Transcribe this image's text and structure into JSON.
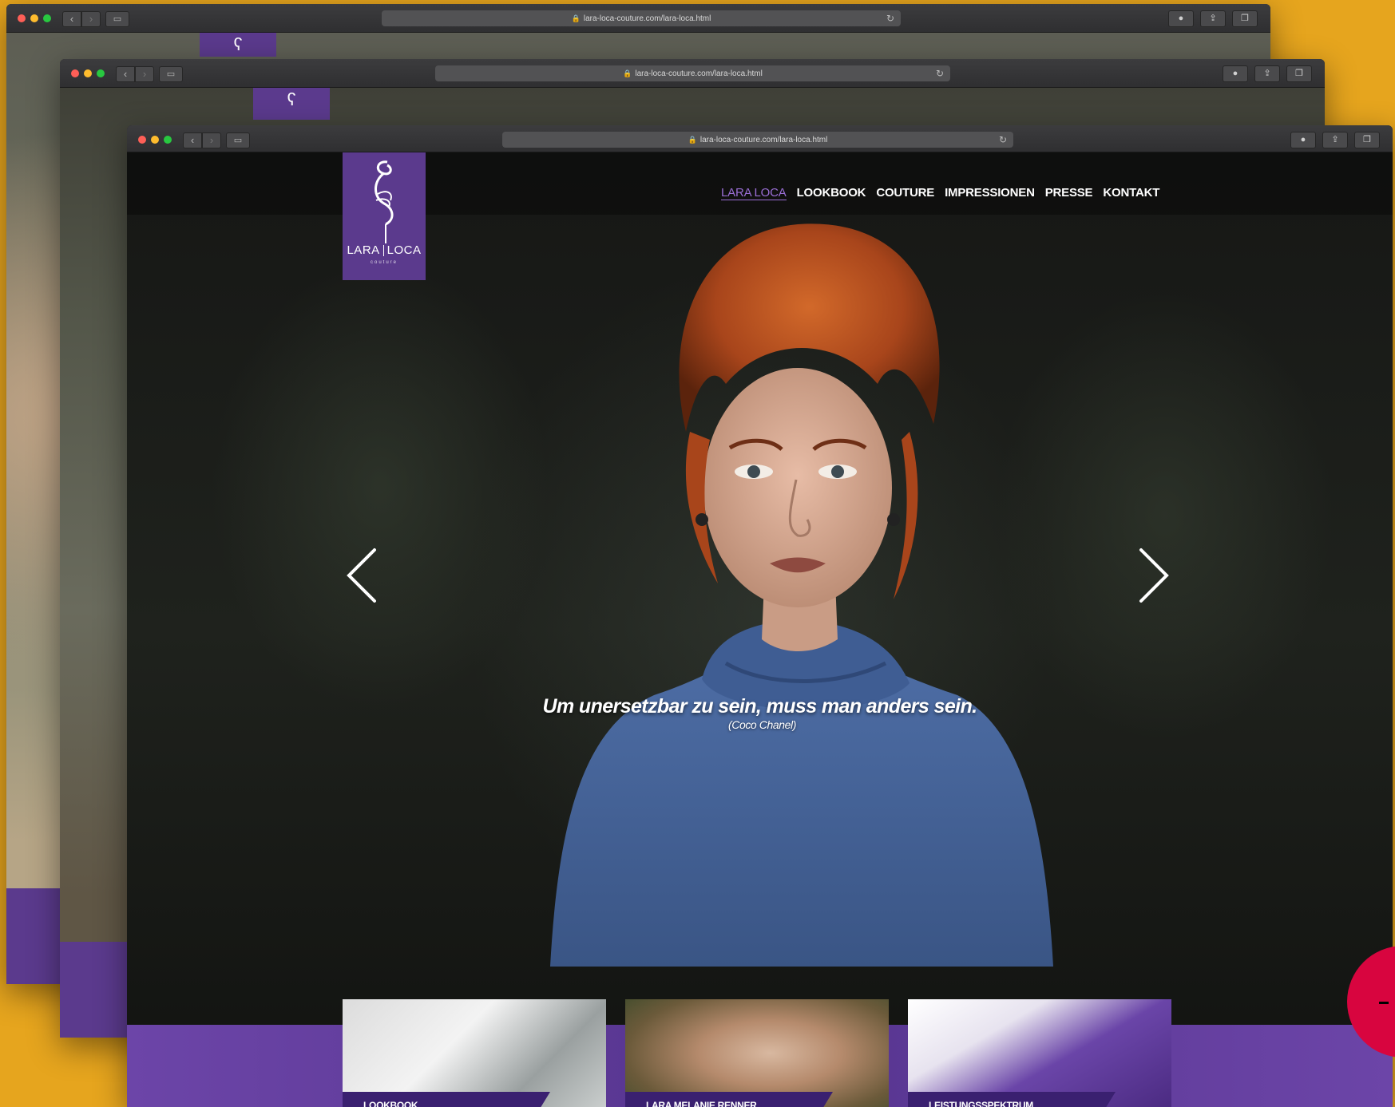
{
  "browser": {
    "url": "lara-loca-couture.com/lara-loca.html"
  },
  "site": {
    "logo": {
      "left": "LARA",
      "right": "LOCA",
      "sub": "couture"
    },
    "nav": [
      {
        "label": "LARA LOCA",
        "active": true
      },
      {
        "label": "LOOKBOOK",
        "active": false
      },
      {
        "label": "COUTURE",
        "active": false
      },
      {
        "label": "IMPRESSIONEN",
        "active": false
      },
      {
        "label": "PRESSE",
        "active": false
      },
      {
        "label": "KONTAKT",
        "active": false
      }
    ],
    "quote": {
      "text": "Um unersetzbar zu sein, muss man anders sein.",
      "author": "(Coco Chanel)"
    },
    "tiles": [
      {
        "label": "LOOKBOOK"
      },
      {
        "label": "LARA MELANIE RENNER"
      },
      {
        "label": "LEISTUNGSSPEKTRUM"
      }
    ]
  },
  "colors": {
    "background": "#e6a51e",
    "brand_purple": "#5b3a8d",
    "nav_active": "#9b6fd6",
    "accent_red": "#d8053f"
  },
  "icons": {
    "logo_mark": "flamingo-icon",
    "prev": "chevron-left-icon",
    "next": "chevron-right-icon"
  }
}
